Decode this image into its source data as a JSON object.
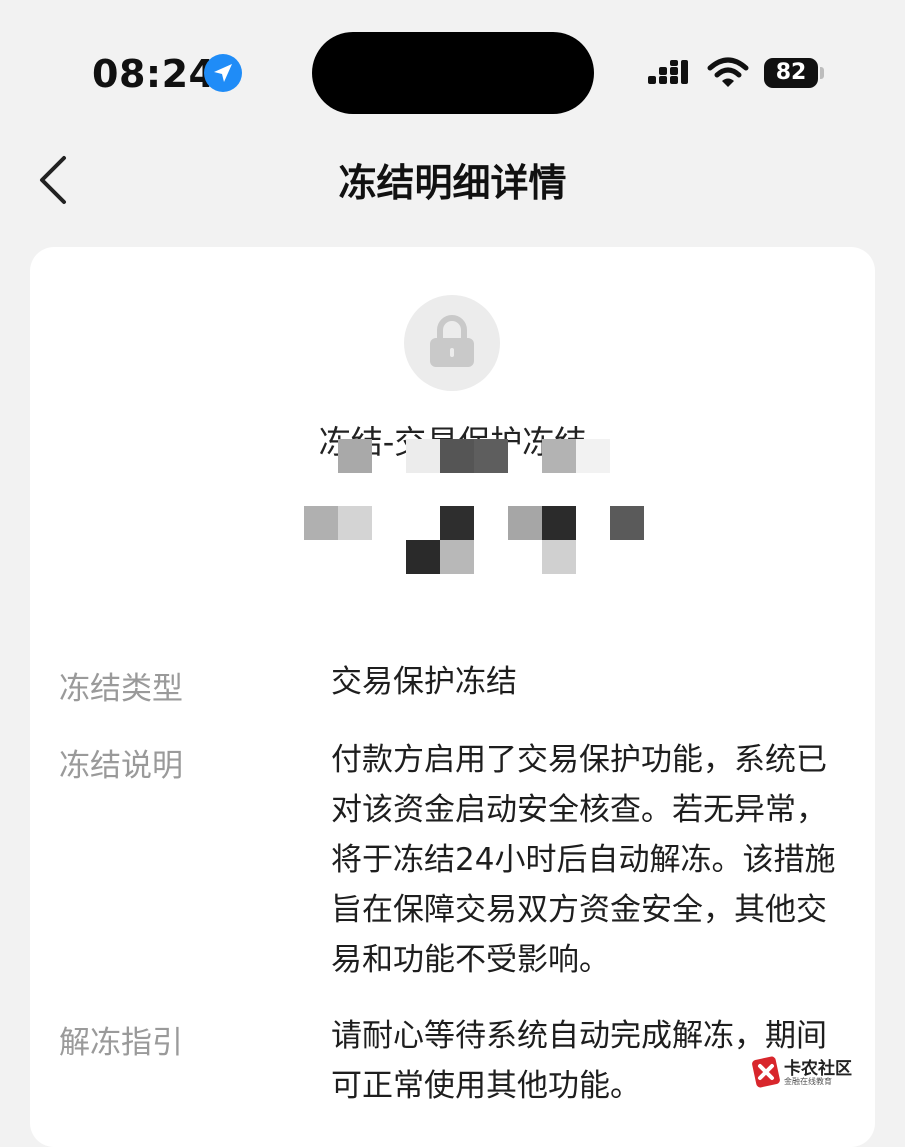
{
  "status_bar": {
    "time": "08:24",
    "battery": "82",
    "icons": [
      "location-arrow-icon",
      "cellular-signal-icon",
      "wifi-icon",
      "battery-icon"
    ]
  },
  "nav": {
    "back_icon": "chevron-left-icon",
    "title": "冻结明细详情"
  },
  "summary": {
    "icon": "lock-icon",
    "heading": "冻结-交易保护冻结"
  },
  "details": [
    {
      "label": "冻结类型",
      "value": "交易保护冻结"
    },
    {
      "label": "冻结说明",
      "value": "付款方启用了交易保护功能，系统已对该资金启动安全核查。若无异常，将于冻结24小时后自动解冻。该措施旨在保障交易双方资金安全，其他交易和功能不受影响。"
    },
    {
      "label": "解冻指引",
      "value": "请耐心等待系统自动完成解冻，期间可正常使用其他功能。"
    }
  ],
  "watermark": {
    "name": "卡农社区",
    "tagline": "金融在线教育"
  },
  "colors": {
    "page_background": "#f2f2f2",
    "card_background": "#ffffff",
    "label_gray": "#9a9a9a",
    "location_blue": "#1f8cf7"
  }
}
